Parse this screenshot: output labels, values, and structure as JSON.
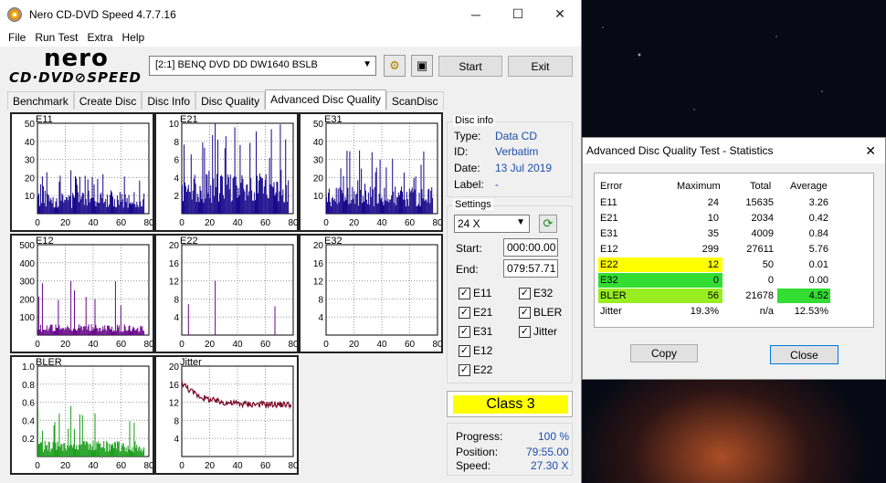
{
  "window": {
    "title": "Nero CD-DVD Speed 4.7.7.16",
    "min": "─",
    "max": "☐",
    "close": "✕"
  },
  "menu": [
    "File",
    "Run Test",
    "Extra",
    "Help"
  ],
  "logo": {
    "line1": "nero",
    "line2": "CD·DVD⊘SPEED"
  },
  "toolbar": {
    "drive": "[2:1]   BENQ DVD DD DW1640 BSLB",
    "start": "Start",
    "exit": "Exit"
  },
  "tabs": [
    "Benchmark",
    "Create Disc",
    "Disc Info",
    "Disc Quality",
    "Advanced Disc Quality",
    "ScanDisc"
  ],
  "active_tab": "Advanced Disc Quality",
  "disc_info": {
    "heading": "Disc info",
    "type_label": "Type:",
    "type": "Data CD",
    "id_label": "ID:",
    "id": "Verbatim",
    "date_label": "Date:",
    "date": "13 Jul 2019",
    "label_label": "Label:",
    "label": "-"
  },
  "settings": {
    "heading": "Settings",
    "speed": "24 X",
    "start_label": "Start:",
    "start": "000:00.00",
    "end_label": "End:",
    "end": "079:57.71",
    "checks": [
      {
        "label": "E11",
        "checked": true
      },
      {
        "label": "E32",
        "checked": true
      },
      {
        "label": "E21",
        "checked": true
      },
      {
        "label": "BLER",
        "checked": true
      },
      {
        "label": "E31",
        "checked": true
      },
      {
        "label": "Jitter",
        "checked": true
      },
      {
        "label": "E12",
        "checked": true
      },
      {
        "label": "E22",
        "checked": true
      }
    ]
  },
  "class_label": "Class 3",
  "progress": {
    "progress_label": "Progress:",
    "progress": "100 %",
    "position_label": "Position:",
    "position": "79:55.00",
    "speed_label": "Speed:",
    "speed": "27.30 X"
  },
  "colors": {
    "navy": "#1a0a8c",
    "purple": "#6a0a8c",
    "green": "#1e9e1e",
    "maroon": "#7a0a2a",
    "yellow": "#ffff00",
    "lime": "#33dd33"
  },
  "chart_data": [
    {
      "type": "bar",
      "title": "E11",
      "x_ticks": [
        "0",
        "20",
        "40",
        "60",
        "80"
      ],
      "y_ticks": [
        "10",
        "20",
        "30",
        "40",
        "50"
      ],
      "ylim": [
        0,
        50
      ],
      "xlim": [
        0,
        80
      ],
      "color": "#1a0a8c",
      "typical": 8,
      "max": 24
    },
    {
      "type": "bar",
      "title": "E21",
      "x_ticks": [
        "0",
        "20",
        "40",
        "60",
        "80"
      ],
      "y_ticks": [
        "2",
        "4",
        "6",
        "8",
        "10"
      ],
      "ylim": [
        0,
        10
      ],
      "xlim": [
        0,
        80
      ],
      "color": "#1a0a8c",
      "typical": 3,
      "max": 10
    },
    {
      "type": "bar",
      "title": "E31",
      "x_ticks": [
        "0",
        "20",
        "40",
        "60",
        "80"
      ],
      "y_ticks": [
        "10",
        "20",
        "30",
        "40",
        "50"
      ],
      "ylim": [
        0,
        50
      ],
      "xlim": [
        0,
        80
      ],
      "color": "#1a0a8c",
      "typical": 10,
      "max": 35
    },
    {
      "type": "bar",
      "title": "E12",
      "x_ticks": [
        "0",
        "20",
        "40",
        "60",
        "80"
      ],
      "y_ticks": [
        "100",
        "200",
        "300",
        "400",
        "500"
      ],
      "ylim": [
        0,
        500
      ],
      "xlim": [
        0,
        80
      ],
      "color": "#6a0a8c",
      "typical": 40,
      "max": 299
    },
    {
      "type": "bar",
      "title": "E22",
      "x_ticks": [
        "0",
        "20",
        "40",
        "60",
        "80"
      ],
      "y_ticks": [
        "4",
        "8",
        "12",
        "16",
        "20"
      ],
      "ylim": [
        0,
        20
      ],
      "xlim": [
        0,
        80
      ],
      "color": "#6a0a8c",
      "typical": 0,
      "max": 12
    },
    {
      "type": "bar",
      "title": "E32",
      "x_ticks": [
        "0",
        "20",
        "40",
        "60",
        "80"
      ],
      "y_ticks": [
        "4",
        "8",
        "12",
        "16",
        "20"
      ],
      "ylim": [
        0,
        20
      ],
      "xlim": [
        0,
        80
      ],
      "color": "#6a0a8c",
      "typical": 0,
      "max": 0
    },
    {
      "type": "bar",
      "title": "BLER",
      "x_ticks": [
        "0",
        "20",
        "40",
        "60",
        "80"
      ],
      "y_ticks": [
        "0.2",
        "0.4",
        "0.6",
        "0.8",
        "1.0"
      ],
      "ylim": [
        0,
        1.0
      ],
      "xlim": [
        0,
        80
      ],
      "color": "#1e9e1e",
      "typical": 0.12,
      "max": 0.56
    },
    {
      "type": "line",
      "title": "Jitter",
      "x_ticks": [
        "0",
        "20",
        "40",
        "60",
        "80"
      ],
      "y_ticks": [
        "4",
        "8",
        "12",
        "16",
        "20"
      ],
      "ylim": [
        0,
        20
      ],
      "xlim": [
        0,
        80
      ],
      "color": "#7a0a2a",
      "start": 16.5,
      "end": 11.5
    }
  ],
  "stats": {
    "title": "Advanced Disc Quality Test - Statistics",
    "headers": [
      "Error",
      "Maximum",
      "Total",
      "Average"
    ],
    "rows": [
      {
        "name": "E11",
        "max": "24",
        "total": "15635",
        "avg": "3.26"
      },
      {
        "name": "E21",
        "max": "10",
        "total": "2034",
        "avg": "0.42"
      },
      {
        "name": "E31",
        "max": "35",
        "total": "4009",
        "avg": "0.84"
      },
      {
        "name": "E12",
        "max": "299",
        "total": "27611",
        "avg": "5.76"
      },
      {
        "name": "E22",
        "max": "12",
        "total": "50",
        "avg": "0.01"
      },
      {
        "name": "E32",
        "max": "0",
        "total": "0",
        "avg": "0.00"
      },
      {
        "name": "BLER",
        "max": "56",
        "total": "21678",
        "avg": "4.52"
      },
      {
        "name": "Jitter",
        "max": "19.3%",
        "total": "n/a",
        "avg": "12.53%"
      }
    ],
    "copy": "Copy",
    "close": "Close"
  }
}
